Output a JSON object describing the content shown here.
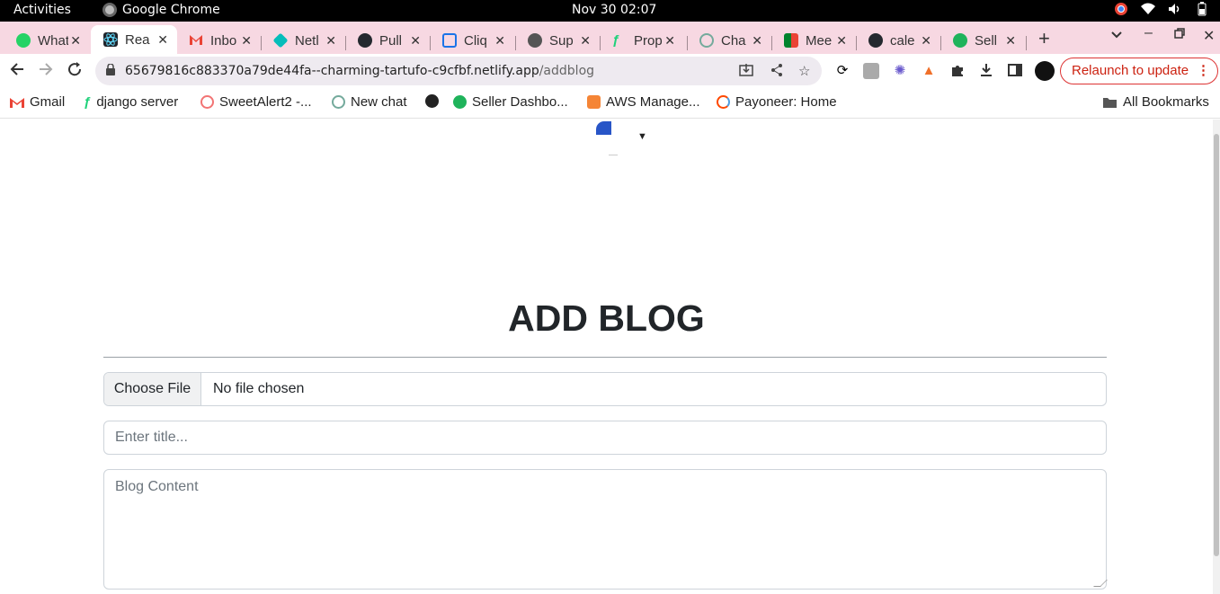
{
  "system": {
    "activities": "Activities",
    "app_name": "Google Chrome",
    "clock": "Nov 30  02:07"
  },
  "tabs": [
    {
      "title": "What",
      "color": "#25d366",
      "active": false
    },
    {
      "title": "Rea",
      "color": "#20232a",
      "active": true
    },
    {
      "title": "Inbo",
      "color": "#ea4335",
      "active": false
    },
    {
      "title": "Netl",
      "color": "#05bdba",
      "active": false
    },
    {
      "title": "Pull",
      "color": "#24292f",
      "active": false
    },
    {
      "title": "Cliq",
      "color": "#1a73e8",
      "active": false
    },
    {
      "title": "Sup",
      "color": "#555555",
      "active": false
    },
    {
      "title": "Prop",
      "color": "#1fd17a",
      "active": false
    },
    {
      "title": "Cha",
      "color": "#74aa9c",
      "active": false
    },
    {
      "title": "Mee",
      "color": "#00832d",
      "active": false
    },
    {
      "title": "cale",
      "color": "#24292f",
      "active": false
    },
    {
      "title": "Sell",
      "color": "#1fb35b",
      "active": false
    }
  ],
  "toolbar": {
    "url_host": "65679816c883370a79de44fa--charming-tartufo-c9cfbf.netlify.app",
    "url_path": "/addblog",
    "relaunch_label": "Relaunch to update"
  },
  "bookmarks": {
    "items": [
      {
        "label": "Gmail",
        "color": "#ea4335"
      },
      {
        "label": "django server",
        "color": "#1fd17a"
      },
      {
        "label": "SweetAlert2 -...",
        "color": "#f27474"
      },
      {
        "label": "New chat",
        "color": "#74aa9c"
      },
      {
        "label": "",
        "color": "#222222"
      },
      {
        "label": "Seller Dashbo...",
        "color": "#1fb35b"
      },
      {
        "label": "AWS Manage...",
        "color": "#f58536"
      },
      {
        "label": "Payoneer: Home",
        "color": "#ff4800"
      }
    ],
    "all_bookmarks": "All Bookmarks"
  },
  "page": {
    "heading": "ADD BLOG",
    "choose_file": "Choose File",
    "no_file": "No file chosen",
    "title_placeholder": "Enter title...",
    "content_placeholder": "Blog Content"
  }
}
